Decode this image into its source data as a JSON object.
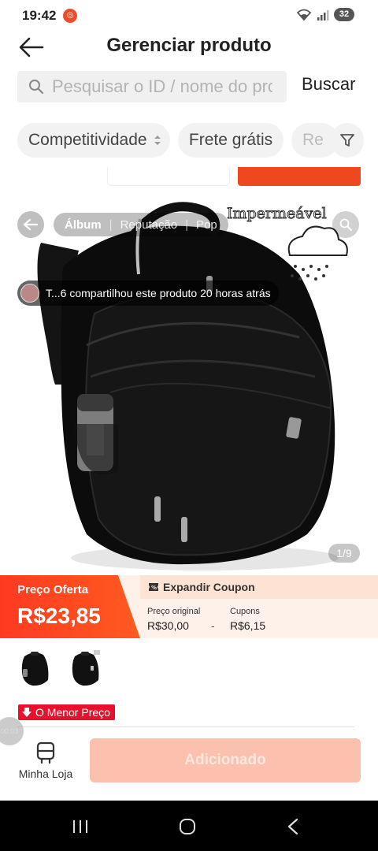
{
  "status_bar": {
    "time": "19:42",
    "battery": "32"
  },
  "header": {
    "title": "Gerenciar produto"
  },
  "search": {
    "placeholder": "Pesquisar o ID / nome do produto",
    "button_label": "Buscar"
  },
  "filters": {
    "competitiveness": "Competitividade",
    "free_shipping": "Frete grátis",
    "truncated": "Re"
  },
  "media": {
    "tabs": [
      "Álbum",
      "Reputação",
      "Pop"
    ],
    "watermark": "Impermeável",
    "share_text": "T...6 compartilhou este produto 20 horas atrás",
    "counter": "1/9"
  },
  "price": {
    "offer_label": "Preço Oferta",
    "offer_value": "R$23,85",
    "coupon_expand": "Expandir Coupon",
    "original_label": "Preço original",
    "original_value": "R$30,00",
    "minus": "-",
    "coupons_label": "Cupons",
    "coupons_value": "R$6,15"
  },
  "badge": {
    "lowest_price": "O Menor Preço"
  },
  "bottom": {
    "timer": "00:03",
    "store_label": "Minha Loja",
    "add_button": "Adicionado"
  },
  "colors": {
    "accent": "#ee4d2d",
    "price_red": "#ff3a21",
    "add_disabled": "#fbc0ae"
  }
}
